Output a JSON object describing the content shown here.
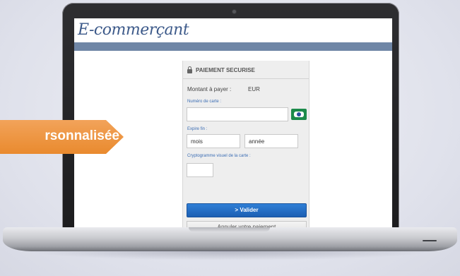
{
  "site": {
    "logo_text": "E-commerçant",
    "bar_color": "#6f86a6"
  },
  "payment_form": {
    "title": "PAIEMENT SECURISE",
    "amount_label": "Montant à payer :",
    "currency": "EUR",
    "card_number_label": "Numéro de carte :",
    "card_number_value": "",
    "expiry_label": "Expire fin :",
    "expiry_month_value": "mois",
    "expiry_year_value": "année",
    "cvv_label": "Cryptogramme visuel de la carte :",
    "cvv_value": "",
    "validate_button": "> Valider",
    "cancel_button": "Annuler votre paiement",
    "accent_color": "#1c5fb3",
    "label_color": "#3b6db4"
  },
  "banner": {
    "text": "rsonnalisée",
    "color": "#e98a2e"
  },
  "icons": [
    "lock-icon",
    "card-icon",
    "camera-icon"
  ]
}
